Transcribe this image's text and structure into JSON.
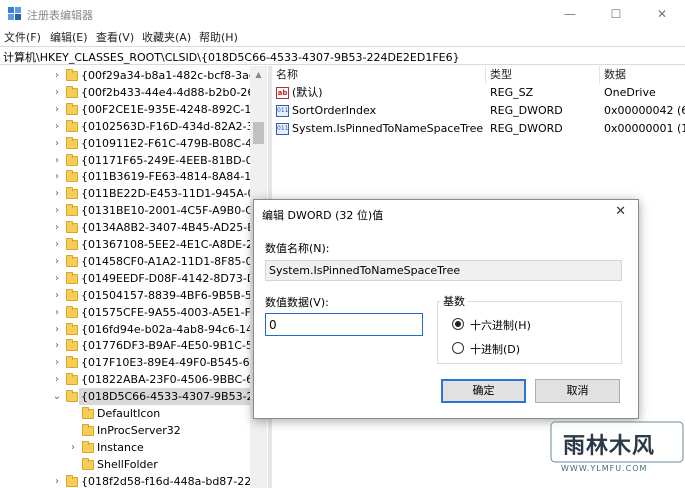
{
  "window": {
    "title": "注册表编辑器",
    "minimize_glyph": "—",
    "maximize_glyph": "☐",
    "close_glyph": "✕"
  },
  "menu": [
    "文件(F)",
    "编辑(E)",
    "查看(V)",
    "收藏夹(A)",
    "帮助(H)"
  ],
  "address": "计算机\\HKEY_CLASSES_ROOT\\CLSID\\{018D5C66-4533-4307-9B53-224DE2ED1FE6}",
  "tree": {
    "items": [
      {
        "label": "{00f29a34-b8a1-482c-bcf8-3ac",
        "chevron": "›"
      },
      {
        "label": "{00f2b433-44e4-4d88-b2b0-26",
        "chevron": "›"
      },
      {
        "label": "{00F2CE1E-935E-4248-892C-13",
        "chevron": "›"
      },
      {
        "label": "{0102563D-F16D-434d-82A2-3",
        "chevron": "›"
      },
      {
        "label": "{010911E2-F61C-479B-B08C-4",
        "chevron": "›"
      },
      {
        "label": "{01171F65-249E-4EEB-81BD-0",
        "chevron": "›"
      },
      {
        "label": "{011B3619-FE63-4814-8A84-1",
        "chevron": "›"
      },
      {
        "label": "{011BE22D-E453-11D1-945A-0",
        "chevron": "›"
      },
      {
        "label": "{0131BE10-2001-4C5F-A9B0-C",
        "chevron": "›"
      },
      {
        "label": "{0134A8B2-3407-4B45-AD25-E",
        "chevron": "›"
      },
      {
        "label": "{01367108-5EE2-4E1C-A8DE-2",
        "chevron": "›"
      },
      {
        "label": "{01458CF0-A1A2-11D1-8F85-0",
        "chevron": "›"
      },
      {
        "label": "{0149EEDF-D08F-4142-8D73-D",
        "chevron": "›"
      },
      {
        "label": "{01504157-8839-4BF6-9B5B-5",
        "chevron": "›"
      },
      {
        "label": "{01575CFE-9A55-4003-A5E1-F",
        "chevron": "›"
      },
      {
        "label": "{016fd94e-b02a-4ab8-94c6-14",
        "chevron": "›"
      },
      {
        "label": "{01776DF3-B9AF-4E50-9B1C-5",
        "chevron": "›"
      },
      {
        "label": "{017F10E3-89E4-49F0-B545-61",
        "chevron": "›"
      },
      {
        "label": "{01822ABA-23F0-4506-9BBC-6",
        "chevron": "›"
      },
      {
        "label": "{018D5C66-4533-4307-9B53-2",
        "chevron": "⌄"
      },
      {
        "label": "DefaultIcon",
        "chevron": ""
      },
      {
        "label": "InProcServer32",
        "chevron": ""
      },
      {
        "label": "Instance",
        "chevron": "›"
      },
      {
        "label": "ShellFolder",
        "chevron": ""
      },
      {
        "label": "{018f2d58-f16d-448a-bd87-22",
        "chevron": "›"
      }
    ]
  },
  "list": {
    "columns": [
      "名称",
      "类型",
      "数据"
    ],
    "rows": [
      {
        "icon": "string-value-icon",
        "icon_glyph": "ab",
        "name": "(默认)",
        "type": "REG_SZ",
        "data": "OneDrive"
      },
      {
        "icon": "dword-value-icon",
        "icon_glyph": "011",
        "name": "SortOrderIndex",
        "type": "REG_DWORD",
        "data": "0x00000042 (6"
      },
      {
        "icon": "dword-value-icon",
        "icon_glyph": "011",
        "name": "System.IsPinnedToNameSpaceTree",
        "type": "REG_DWORD",
        "data": "0x00000001 (1"
      }
    ]
  },
  "dialog": {
    "title": "编辑 DWORD (32 位)值",
    "close_glyph": "✕",
    "name_label": "数值名称(N):",
    "name_value": "System.IsPinnedToNameSpaceTree",
    "data_label": "数值数据(V):",
    "data_value": "0",
    "base_label": "基数",
    "base_options": [
      {
        "label": "十六进制(H)",
        "checked": true
      },
      {
        "label": "十进制(D)",
        "checked": false
      }
    ],
    "ok_label": "确定",
    "cancel_label": "取消"
  },
  "watermark": {
    "main": "雨林木风",
    "sub": "WWW.YLMFU.COM"
  },
  "colors": {
    "accent": "#2a74d6",
    "folder": "#f7cd57"
  }
}
